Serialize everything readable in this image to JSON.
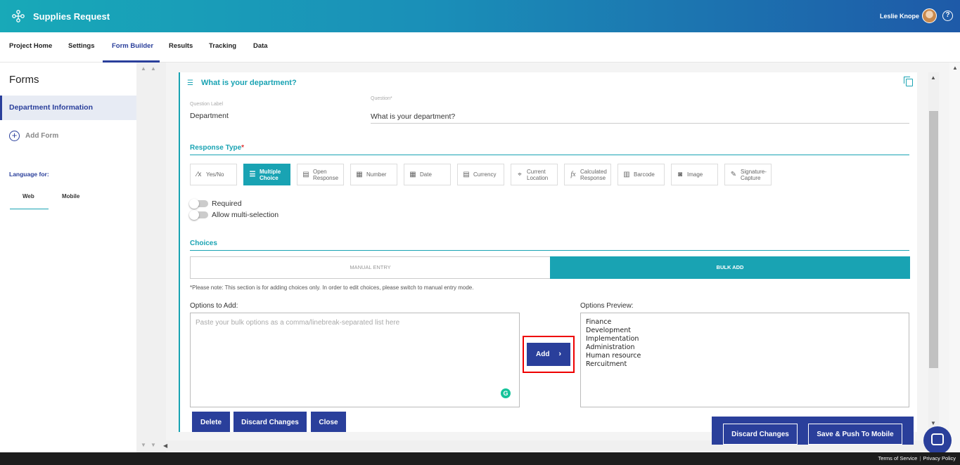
{
  "header": {
    "app_title": "Supplies Request",
    "user_name": "Leslie Knope",
    "logo_icon": "network-logo-icon",
    "help_icon": "question-circle-icon",
    "help_glyph": "?"
  },
  "tabs": [
    {
      "label": "Project Home"
    },
    {
      "label": "Settings"
    },
    {
      "label": "Form Builder",
      "active": true
    },
    {
      "label": "Results"
    },
    {
      "label": "Tracking"
    },
    {
      "label": "Data"
    }
  ],
  "sidebar": {
    "title": "Forms",
    "active_form": "Department Information",
    "add_form_icon": "+",
    "add_form": "Add Form",
    "language_label": "Language for:",
    "language_tabs": [
      "Web",
      "Mobile"
    ]
  },
  "question": {
    "title": "What is your department?",
    "question_label_caption": "Question Label",
    "question_label_value": "Department",
    "question_caption": "Question*",
    "question_value": "What is your department?"
  },
  "response_type": {
    "title": "Response Type",
    "required_mark": "*",
    "options": [
      {
        "label1": "Yes/No",
        "label2": "",
        "icon": "x-check-icon",
        "glyph": "⁄x"
      },
      {
        "label1": "Multiple",
        "label2": "Choice",
        "icon": "list-icon",
        "glyph": "☰",
        "active": true
      },
      {
        "label1": "Open",
        "label2": "Response",
        "icon": "text-box-icon",
        "glyph": "▤"
      },
      {
        "label1": "Number",
        "label2": "",
        "icon": "number-grid-icon",
        "glyph": "▦"
      },
      {
        "label1": "Date",
        "label2": "",
        "icon": "calendar-icon",
        "glyph": "▦"
      },
      {
        "label1": "Currency",
        "label2": "",
        "icon": "currency-icon",
        "glyph": "▤"
      },
      {
        "label1": "Current",
        "label2": "Location",
        "icon": "location-pin-icon",
        "glyph": "⌖"
      },
      {
        "label1": "Calculated",
        "label2": "Response",
        "icon": "function-icon",
        "glyph": "fx"
      },
      {
        "label1": "Barcode",
        "label2": "",
        "icon": "barcode-icon",
        "glyph": "▥"
      },
      {
        "label1": "Image",
        "label2": "",
        "icon": "camera-icon",
        "glyph": "◙"
      },
      {
        "label1": "Signature-",
        "label2": "Capture",
        "icon": "pen-icon",
        "glyph": "✎"
      }
    ]
  },
  "toggles": {
    "required": "Required",
    "multi": "Allow multi-selection"
  },
  "choices": {
    "title": "Choices",
    "manual_tab": "MANUAL ENTRY",
    "bulk_tab": "BULK ADD",
    "note": "*Please note: This section is for adding choices only. In order to edit choices, please switch to manual entry mode.",
    "options_to_add_label": "Options to Add:",
    "options_placeholder": "Paste your bulk options as a comma/linebreak-separated list here",
    "grammarly_glyph": "G",
    "add_button": "Add",
    "add_chevron": "›",
    "preview_label": "Options Preview:",
    "preview_items": [
      "Finance",
      "Development",
      "Implementation",
      "Administration",
      "Human resource",
      "Rercuitment"
    ]
  },
  "actions": {
    "delete": "Delete",
    "discard": "Discard Changes",
    "close": "Close"
  },
  "footer_panel": {
    "discard": "Discard Changes",
    "save_push": "Save & Push To Mobile"
  },
  "bottom": {
    "terms": "Terms of Service",
    "separator": "|",
    "privacy": "Privacy Policy"
  },
  "colors": {
    "accent_teal": "#19a3b3",
    "primary_navy": "#2a3f9b",
    "highlight_red": "#e00000"
  }
}
